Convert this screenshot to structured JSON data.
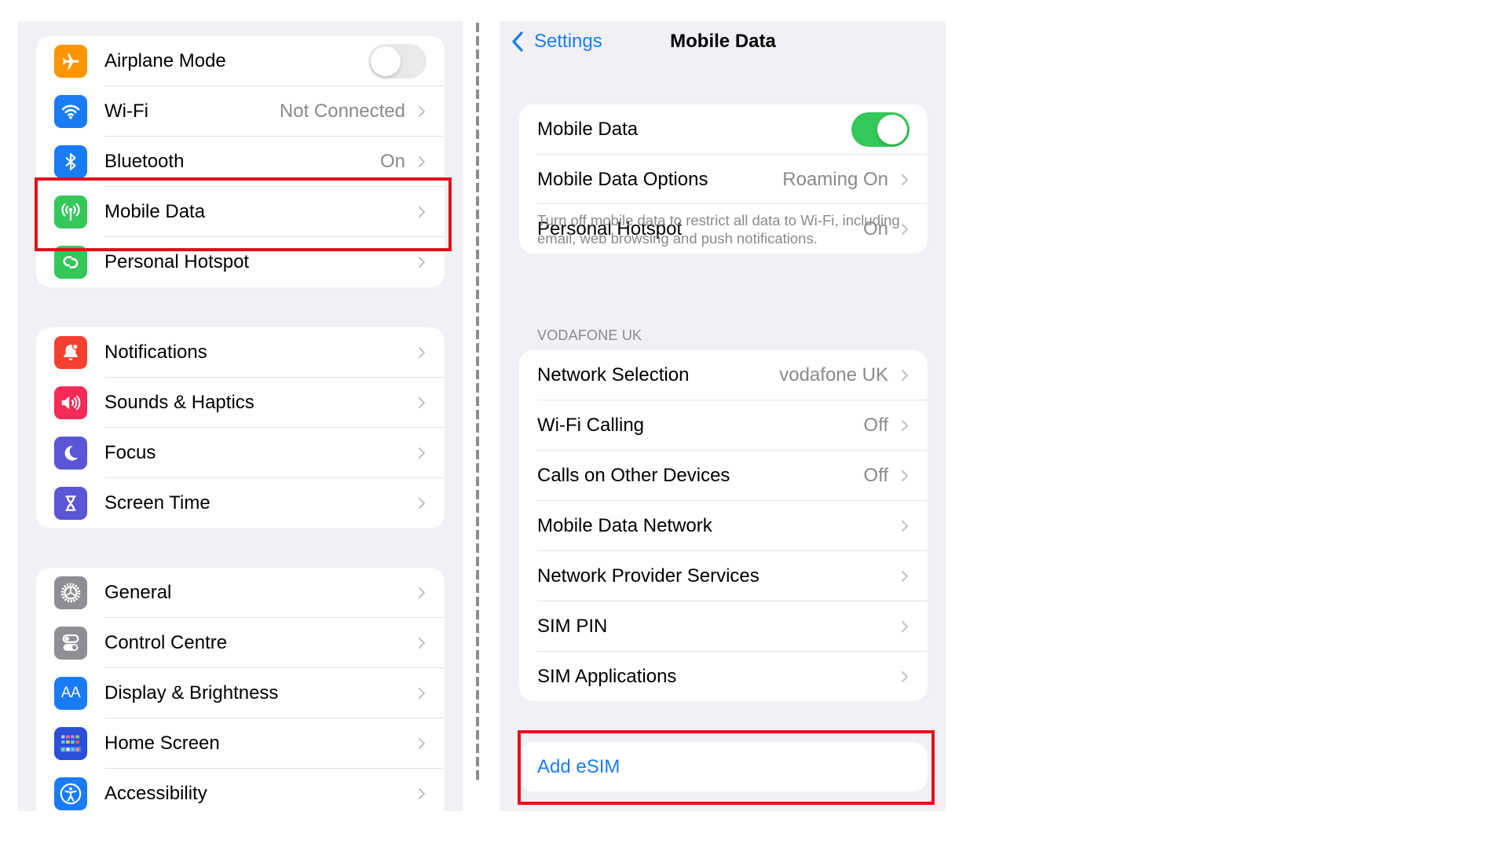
{
  "left_panel": {
    "groups": [
      {
        "items": [
          {
            "label": "Airplane Mode",
            "icon": "airplane-icon",
            "icon_color": "#ff9500",
            "control": "toggle",
            "toggle_on": false
          },
          {
            "label": "Wi-Fi",
            "icon": "wifi-icon",
            "icon_color": "#1a7cf5",
            "value": "Not Connected",
            "control": "chevron"
          },
          {
            "label": "Bluetooth",
            "icon": "bluetooth-icon",
            "icon_color": "#1a7cf5",
            "value": "On",
            "control": "chevron"
          },
          {
            "label": "Mobile Data",
            "icon": "antenna-icon",
            "icon_color": "#34c759",
            "control": "chevron",
            "highlighted": true
          },
          {
            "label": "Personal Hotspot",
            "icon": "hotspot-link-icon",
            "icon_color": "#34c759",
            "control": "chevron"
          }
        ]
      },
      {
        "items": [
          {
            "label": "Notifications",
            "icon": "bell-icon",
            "icon_color": "#f5402f",
            "control": "chevron"
          },
          {
            "label": "Sounds & Haptics",
            "icon": "speaker-icon",
            "icon_color": "#f52a56",
            "control": "chevron"
          },
          {
            "label": "Focus",
            "icon": "moon-icon",
            "icon_color": "#5a56d6",
            "control": "chevron"
          },
          {
            "label": "Screen Time",
            "icon": "hourglass-icon",
            "icon_color": "#5a56d6",
            "control": "chevron"
          }
        ]
      },
      {
        "items": [
          {
            "label": "General",
            "icon": "gear-icon",
            "icon_color": "#8e8e93",
            "control": "chevron"
          },
          {
            "label": "Control Centre",
            "icon": "switches-icon",
            "icon_color": "#8e8e93",
            "control": "chevron"
          },
          {
            "label": "Display & Brightness",
            "icon": "text-size-icon",
            "icon_color": "#1a7cf5",
            "icon_text": "AA",
            "control": "chevron"
          },
          {
            "label": "Home Screen",
            "icon": "app-grid-icon",
            "icon_color": "#2a4fd8",
            "control": "chevron"
          },
          {
            "label": "Accessibility",
            "icon": "accessibility-icon",
            "icon_color": "#1a7cf5",
            "control": "chevron"
          }
        ]
      }
    ]
  },
  "right_panel": {
    "nav": {
      "back_label": "Settings",
      "title": "Mobile Data"
    },
    "group1": {
      "items": [
        {
          "label": "Mobile Data",
          "control": "toggle",
          "toggle_on": true
        },
        {
          "label": "Mobile Data Options",
          "value": "Roaming On",
          "control": "chevron"
        },
        {
          "label": "Personal Hotspot",
          "value": "On",
          "control": "chevron"
        }
      ],
      "footer": "Turn off mobile data to restrict all data to Wi-Fi, including email, web browsing and push notifications."
    },
    "group2": {
      "header": "VODAFONE UK",
      "items": [
        {
          "label": "Network Selection",
          "value": "vodafone UK",
          "control": "chevron"
        },
        {
          "label": "Wi-Fi Calling",
          "value": "Off",
          "control": "chevron"
        },
        {
          "label": "Calls on Other Devices",
          "value": "Off",
          "control": "chevron"
        },
        {
          "label": "Mobile Data Network",
          "control": "chevron"
        },
        {
          "label": "Network Provider Services",
          "control": "chevron"
        },
        {
          "label": "SIM PIN",
          "control": "chevron"
        },
        {
          "label": "SIM Applications",
          "control": "chevron"
        }
      ]
    },
    "group3": {
      "action_label": "Add eSIM",
      "highlighted": true
    }
  },
  "colors": {
    "accent_blue": "#1a7df0",
    "toggle_on": "#34c759",
    "toggle_off": "#e9e9eb",
    "highlight_red": "#e3101a",
    "background": "#f0f0f5",
    "secondary_text": "#8a8a8e"
  }
}
